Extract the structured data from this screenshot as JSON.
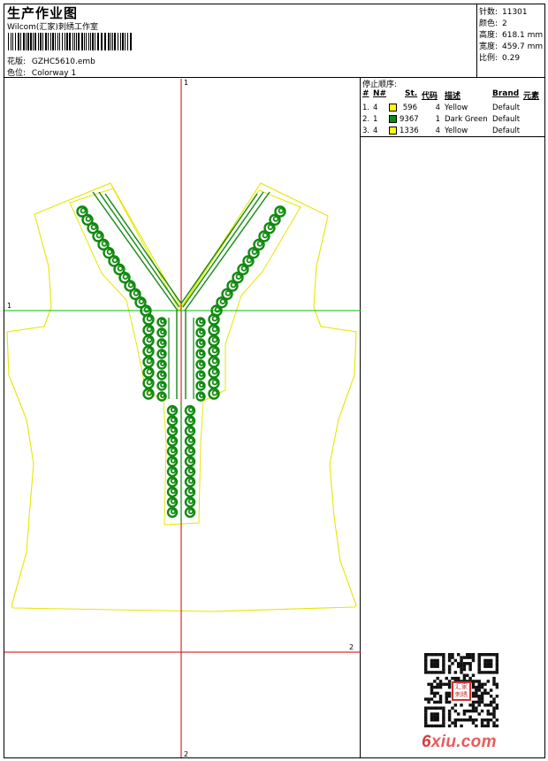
{
  "header": {
    "title": "生产作业图",
    "subtitle": "Wilcom(汇家)刺绣工作室",
    "design_label": "花版:",
    "design_value": "GZHC5610.emb",
    "colorway_label": "色位:",
    "colorway_value": "Colorway 1"
  },
  "stats": [
    {
      "label": "针数:",
      "value": "11301"
    },
    {
      "label": "颜色:",
      "value": "2"
    },
    {
      "label": "高度:",
      "value": "618.1 mm"
    },
    {
      "label": "宽度:",
      "value": "459.7 mm"
    },
    {
      "label": "比例:",
      "value": "0.29"
    }
  ],
  "stop_sequence": {
    "title": "停止顺序:",
    "headers": [
      "#",
      "N#",
      "St.",
      "代码",
      "描述",
      "Brand",
      "元素"
    ],
    "rows": [
      {
        "index": "1.",
        "needle": "4",
        "color": "#ffff00",
        "stitches": "596",
        "code": "4",
        "desc": "Yellow",
        "brand": "Default"
      },
      {
        "index": "2.",
        "needle": "1",
        "color": "#108a10",
        "stitches": "9367",
        "code": "1",
        "desc": "Dark Green",
        "brand": "Default"
      },
      {
        "index": "3.",
        "needle": "4",
        "color": "#ffff00",
        "stitches": "1336",
        "code": "4",
        "desc": "Yellow",
        "brand": "Default"
      }
    ]
  },
  "design": {
    "axis_color": "#cc0000",
    "green_axis_color": "#00c000",
    "outline_color": "#e6e600",
    "embroidery_color": "#108a10",
    "v_axis_top_label": "1",
    "v_axis_bottom_label": "2",
    "h_axis_left_label": "1",
    "h_axis2_right_label": "2"
  },
  "watermark": {
    "brand": "6",
    "rest": "xiu.com"
  },
  "stamp": {
    "text": "汇家刺绣"
  }
}
